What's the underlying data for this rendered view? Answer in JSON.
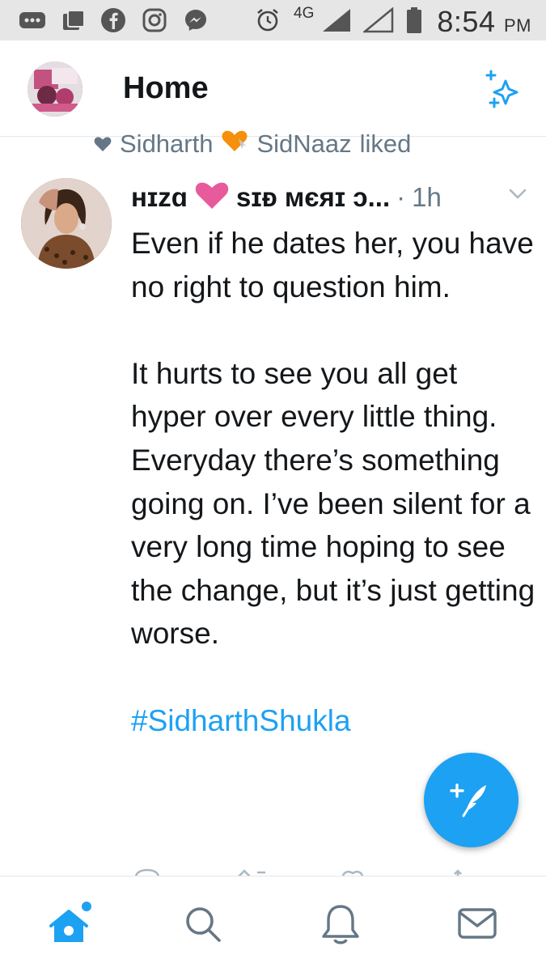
{
  "status_bar": {
    "network": "4G",
    "time": "8:54",
    "ampm": "PM",
    "icons": [
      "more-notifications-icon",
      "gallery-icon",
      "facebook-icon",
      "instagram-icon",
      "messenger-icon",
      "alarm-icon",
      "signal-icon",
      "signal-icon-2",
      "battery-icon"
    ]
  },
  "header": {
    "title": "Home",
    "right_icon": "sparkle-icon"
  },
  "context": {
    "user1": "Sidharth",
    "user2": "SidNaaz",
    "verb": "liked"
  },
  "tweet": {
    "name_part1": "ʜɪzɑ",
    "name_part2": "sɪᴆ ᴍєяɪ ɔ...",
    "separator": "·",
    "time": "1h",
    "paragraph1": "Even if he dates her, you have no right to question him.",
    "paragraph2": "It hurts to see you all get hyper over every little thing. Everyday there’s something going on. I’ve been silent for a very long time hoping to see the change, but it’s just getting worse.",
    "hashtag": "#SidharthShukla"
  },
  "colors": {
    "accent": "#1da1f2",
    "text": "#14171a",
    "secondary": "#657786",
    "heart": "#e0245e"
  },
  "bottom_nav": [
    "home-icon",
    "search-icon",
    "notifications-icon",
    "messages-icon"
  ]
}
